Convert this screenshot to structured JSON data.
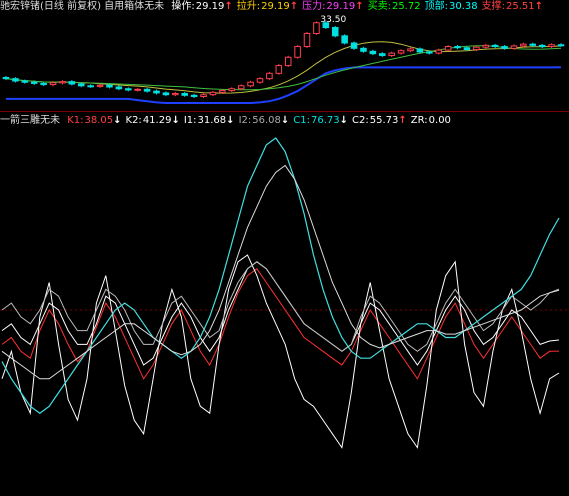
{
  "top_bar": {
    "title": "驰宏锌锗(日线 前复权) 自用箱体无未",
    "items": [
      {
        "label": "操作:",
        "value": "29.19",
        "arrow": "↑",
        "color": "#ffffff",
        "valcolor": "#ffffff",
        "arrowcolor": "#ff4040"
      },
      {
        "label": "拉升:",
        "value": "29.19",
        "arrow": "↑",
        "color": "#ffd000",
        "valcolor": "#ffd000",
        "arrowcolor": "#ff4040"
      },
      {
        "label": "压力:",
        "value": "29.19",
        "arrow": "↑",
        "color": "#ff40ff",
        "valcolor": "#ff40ff",
        "arrowcolor": "#ff4040"
      },
      {
        "label": "买卖:",
        "value": "25.72",
        "arrow": "",
        "color": "#00ff00",
        "valcolor": "#00ff00",
        "arrowcolor": "#ff4040"
      },
      {
        "label": "顶部:",
        "value": "30.38",
        "arrow": "",
        "color": "#00ffff",
        "valcolor": "#00ffff",
        "arrowcolor": "#ff4040"
      },
      {
        "label": "支撑:",
        "value": "25.51",
        "arrow": "↑",
        "color": "#ff4040",
        "valcolor": "#ff4040",
        "arrowcolor": "#ff4040"
      }
    ],
    "price_marker": "33.50"
  },
  "mid_bar": {
    "title": "一箭三雕无未",
    "items": [
      {
        "label": "K1:",
        "value": "38.05",
        "arrow": "↓",
        "color": "#ff4040",
        "valcolor": "#ff4040",
        "arrowcolor": "#ffffff"
      },
      {
        "label": "K2:",
        "value": "41.29",
        "arrow": "↓",
        "color": "#ffffff",
        "valcolor": "#ffffff",
        "arrowcolor": "#ffffff"
      },
      {
        "label": "I1:",
        "value": "31.68",
        "arrow": "↓",
        "color": "#ffffff",
        "valcolor": "#ffffff",
        "arrowcolor": "#ffffff"
      },
      {
        "label": "I2:",
        "value": "56.08",
        "arrow": "↓",
        "color": "#aaaaaa",
        "valcolor": "#aaaaaa",
        "arrowcolor": "#ffffff"
      },
      {
        "label": "C1:",
        "value": "76.73",
        "arrow": "↓",
        "color": "#00e0e0",
        "valcolor": "#00e0e0",
        "arrowcolor": "#ffffff"
      },
      {
        "label": "C2:",
        "value": "55.73",
        "arrow": "↑",
        "color": "#ffffff",
        "valcolor": "#ffffff",
        "arrowcolor": "#ff4040"
      },
      {
        "label": "ZR:",
        "value": "0.00",
        "arrow": "",
        "color": "#ffffff",
        "valcolor": "#ffffff",
        "arrowcolor": "#ffffff"
      }
    ]
  },
  "chart_data": [
    {
      "type": "candlestick",
      "title": "驰宏锌锗(日线 前复权)",
      "note_label": "33.50",
      "series": [
        {
          "name": "close",
          "values": [
            23.6,
            23.2,
            23.0,
            22.8,
            22.6,
            22.9,
            23.1,
            22.7,
            22.4,
            22.3,
            22.5,
            22.2,
            21.9,
            21.7,
            21.8,
            21.5,
            21.2,
            20.9,
            21.1,
            20.8,
            20.6,
            20.9,
            21.3,
            21.6,
            21.9,
            22.4,
            23.0,
            23.6,
            24.5,
            25.8,
            27.2,
            29.0,
            31.2,
            33.0,
            32.2,
            30.8,
            29.6,
            28.7,
            28.2,
            27.8,
            27.5,
            27.9,
            28.3,
            28.6,
            28.1,
            27.9,
            28.4,
            29.0,
            28.8,
            28.5,
            28.9,
            29.2,
            29.0,
            28.7,
            29.1,
            29.4,
            29.2,
            29.0,
            29.3,
            29.19
          ]
        }
      ],
      "support_line": [
        20.2,
        20.2,
        20.2,
        20.2,
        20.2,
        20.2,
        20.2,
        20.2,
        20.2,
        20.2,
        20.2,
        20.2,
        20.2,
        20.2,
        20.0,
        19.8,
        19.6,
        19.5,
        19.5,
        19.5,
        19.5,
        19.5,
        19.5,
        19.5,
        19.5,
        19.5,
        19.5,
        19.6,
        19.8,
        20.2,
        20.8,
        21.5,
        22.5,
        23.5,
        24.5,
        25.0,
        25.3,
        25.5,
        25.5,
        25.5,
        25.5,
        25.5,
        25.5,
        25.5,
        25.5,
        25.5,
        25.5,
        25.5,
        25.5,
        25.5,
        25.5,
        25.5,
        25.5,
        25.5,
        25.5,
        25.5,
        25.5,
        25.5,
        25.5,
        25.51
      ]
    },
    {
      "type": "line",
      "title": "一箭三雕无未",
      "ylim": [
        0,
        100
      ],
      "series": [
        {
          "name": "K1",
          "values": [
            40,
            42,
            38,
            36,
            44,
            50,
            46,
            40,
            35,
            38,
            45,
            52,
            48,
            42,
            36,
            30,
            34,
            40,
            46,
            50,
            44,
            38,
            34,
            40,
            48,
            55,
            60,
            62,
            58,
            54,
            50,
            46,
            42,
            40,
            38,
            36,
            34,
            38,
            44,
            50,
            46,
            42,
            38,
            34,
            30,
            36,
            42,
            48,
            52,
            46,
            40,
            36,
            40,
            44,
            48,
            44,
            40,
            36,
            38,
            38.05
          ]
        },
        {
          "name": "K2",
          "values": [
            44,
            46,
            42,
            40,
            46,
            52,
            50,
            44,
            40,
            40,
            46,
            54,
            52,
            46,
            40,
            34,
            36,
            42,
            48,
            52,
            48,
            42,
            38,
            42,
            50,
            56,
            62,
            64,
            62,
            58,
            54,
            50,
            46,
            44,
            42,
            40,
            38,
            40,
            46,
            52,
            50,
            46,
            42,
            38,
            34,
            38,
            44,
            50,
            54,
            50,
            44,
            40,
            42,
            46,
            50,
            48,
            44,
            40,
            41,
            41.29
          ]
        },
        {
          "name": "I1",
          "values": [
            30,
            38,
            26,
            20,
            48,
            58,
            40,
            24,
            18,
            30,
            52,
            60,
            44,
            28,
            18,
            14,
            30,
            46,
            56,
            48,
            30,
            22,
            20,
            40,
            56,
            64,
            66,
            60,
            52,
            46,
            40,
            30,
            24,
            22,
            18,
            14,
            10,
            26,
            46,
            58,
            44,
            30,
            22,
            14,
            10,
            28,
            50,
            60,
            64,
            40,
            26,
            22,
            38,
            50,
            56,
            44,
            30,
            20,
            30,
            31.68
          ]
        },
        {
          "name": "I2",
          "values": [
            50,
            52,
            48,
            46,
            50,
            56,
            54,
            48,
            44,
            44,
            50,
            56,
            54,
            50,
            44,
            40,
            40,
            46,
            52,
            54,
            50,
            46,
            42,
            44,
            52,
            58,
            62,
            64,
            62,
            58,
            54,
            50,
            46,
            44,
            42,
            40,
            38,
            40,
            48,
            54,
            52,
            48,
            44,
            40,
            38,
            40,
            46,
            52,
            56,
            52,
            48,
            44,
            46,
            50,
            54,
            52,
            50,
            52,
            55,
            56.08
          ]
        },
        {
          "name": "C1",
          "values": [
            35,
            30,
            26,
            22,
            20,
            22,
            26,
            30,
            34,
            38,
            42,
            46,
            50,
            52,
            50,
            46,
            42,
            40,
            38,
            36,
            38,
            42,
            48,
            56,
            66,
            76,
            86,
            92,
            98,
            100,
            96,
            88,
            78,
            66,
            56,
            48,
            42,
            38,
            36,
            36,
            38,
            40,
            42,
            44,
            46,
            46,
            44,
            42,
            42,
            44,
            46,
            48,
            50,
            52,
            54,
            56,
            60,
            66,
            72,
            76.73
          ]
        },
        {
          "name": "C2",
          "values": [
            38,
            36,
            34,
            32,
            30,
            30,
            32,
            34,
            36,
            38,
            40,
            42,
            44,
            46,
            46,
            44,
            42,
            40,
            38,
            37,
            38,
            40,
            44,
            50,
            58,
            66,
            74,
            80,
            86,
            90,
            92,
            88,
            82,
            74,
            66,
            58,
            52,
            46,
            42,
            40,
            39,
            40,
            41,
            42,
            43,
            44,
            44,
            43,
            43,
            44,
            45,
            46,
            47,
            48,
            49,
            50,
            52,
            54,
            55,
            55.73
          ]
        }
      ]
    }
  ]
}
